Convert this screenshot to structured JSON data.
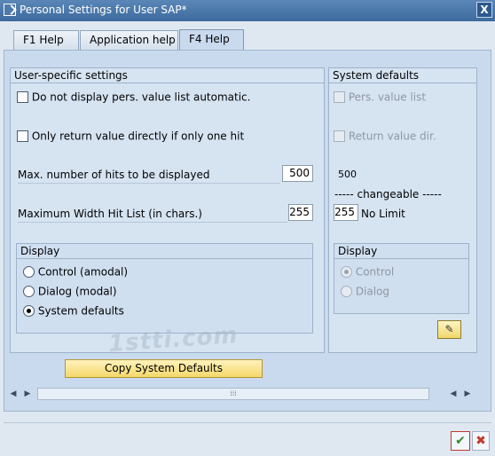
{
  "window": {
    "title": "Personal Settings for User SAP*",
    "close_label": "X"
  },
  "tabs": [
    {
      "label": "F1 Help",
      "active": false
    },
    {
      "label": "Application help",
      "active": false
    },
    {
      "label": "F4 Help",
      "active": true
    }
  ],
  "user_settings": {
    "title": "User-specific settings",
    "no_display_pers_list": {
      "label": "Do not display pers. value list automatic.",
      "checked": false
    },
    "only_return_value": {
      "label": "Only return value directly if only one hit",
      "checked": false
    },
    "max_hits": {
      "label": "Max. number of hits to be displayed",
      "value": "500"
    },
    "max_width": {
      "label": "Maximum Width Hit List (in chars.)",
      "value": "255"
    },
    "display": {
      "title": "Display",
      "options": [
        {
          "label": "Control (amodal)",
          "selected": false
        },
        {
          "label": "Dialog (modal)",
          "selected": false
        },
        {
          "label": "System defaults",
          "selected": true
        }
      ]
    }
  },
  "system_defaults": {
    "title": "System defaults",
    "pers_value_list": {
      "label": "Pers. value list",
      "checked": false
    },
    "return_value_dir": {
      "label": "Return value dir.",
      "checked": false
    },
    "max_hits_value": "500",
    "changeable_label": "----- changeable -----",
    "width_value": "255",
    "no_limit_label": "No Limit",
    "display": {
      "title": "Display",
      "options": [
        {
          "label": "Control",
          "selected": true
        },
        {
          "label": "Dialog",
          "selected": false
        }
      ]
    }
  },
  "buttons": {
    "copy_system_defaults": "Copy System Defaults",
    "ok_glyph": "✔",
    "cancel_glyph": "✖",
    "edit_glyph": "✎"
  },
  "watermark": "1stti.com"
}
